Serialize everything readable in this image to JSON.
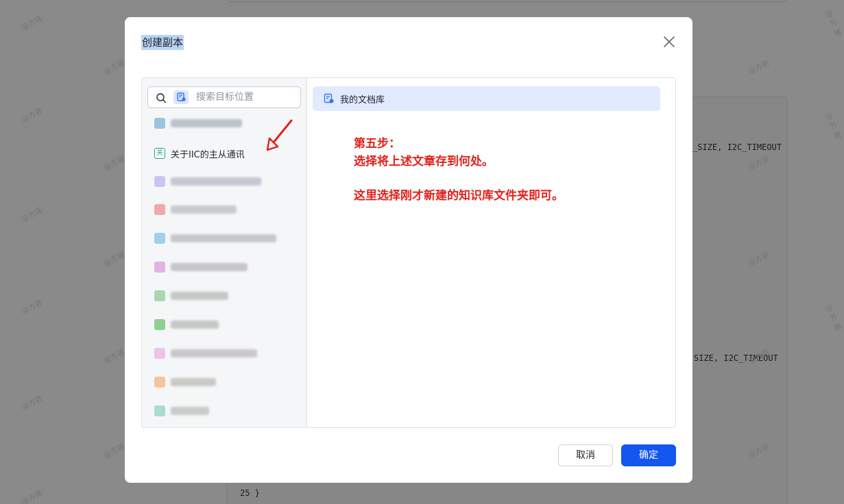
{
  "background": {
    "code_lines": [
      {
        "text": "_SIZE, I2C_TIMEOUT"
      },
      {
        "text": "SIZE, I2C_TIMEOUT"
      },
      {
        "text": "25        }"
      }
    ],
    "watermark": "@方蒋"
  },
  "dialog": {
    "title": "创建副本",
    "search": {
      "placeholder": "搜索目标位置",
      "value": ""
    },
    "libraries": [
      {
        "label": "",
        "icon_color": "#9cc4dc",
        "blurred": true
      },
      {
        "label": "关于IIC的主从通讯",
        "icon_glyph": "关",
        "icon_color": "#2aa27a",
        "blurred": false
      },
      {
        "label": "",
        "icon_color": "#c8c6f0",
        "blurred": true
      },
      {
        "label": "",
        "icon_color": "#f2a9a9",
        "blurred": true
      },
      {
        "label": "",
        "icon_color": "#9ed0ea",
        "blurred": true
      },
      {
        "label": "",
        "icon_color": "#e3b3e6",
        "blurred": true
      },
      {
        "label": "",
        "icon_color": "#a7d8b0",
        "blurred": true
      },
      {
        "label": "",
        "icon_color": "#8fcf93",
        "blurred": true
      },
      {
        "label": "",
        "icon_color": "#eec3ea",
        "blurred": true
      },
      {
        "label": "",
        "icon_color": "#f5c49f",
        "blurred": true
      },
      {
        "label": "",
        "icon_color": "#a9dccd",
        "blurred": true
      }
    ],
    "selected_location": {
      "label": "我的文档库"
    },
    "annotation": {
      "line1": "第五步：",
      "line2": "选择将上述文章存到何处。",
      "line3": "这里选择刚才新建的知识库文件夹即可。"
    },
    "buttons": {
      "cancel": "取消",
      "confirm": "确定"
    },
    "colors": {
      "primary": "#1456f0",
      "annotation_red": "#e3201b",
      "selected_bg": "#e1eaff"
    }
  }
}
